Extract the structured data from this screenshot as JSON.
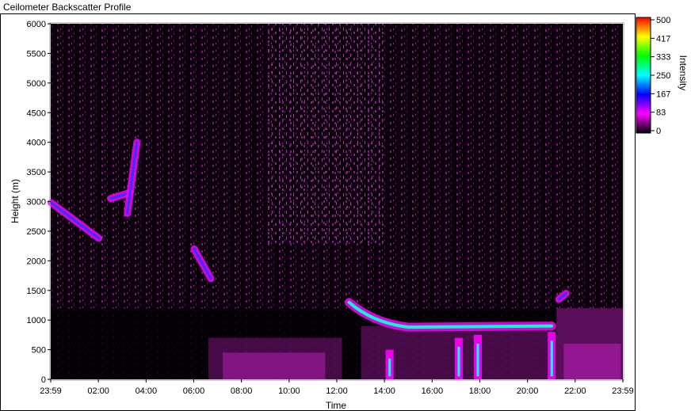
{
  "window": {
    "title": "Ceilometer Backscatter Profile"
  },
  "chart_data": {
    "type": "heatmap",
    "xlabel": "Time",
    "ylabel": "Height (m)",
    "x_ticks": [
      "23:59",
      "02:00",
      "04:00",
      "06:00",
      "08:00",
      "10:00",
      "12:00",
      "14:00",
      "16:00",
      "18:00",
      "20:00",
      "22:00",
      "23:59"
    ],
    "x_range_hours": [
      -0.0167,
      23.983
    ],
    "y_ticks": [
      0,
      500,
      1000,
      1500,
      2000,
      2500,
      3000,
      3500,
      4000,
      4500,
      5000,
      5500,
      6000
    ],
    "ylim": [
      0,
      6000
    ],
    "grid": false,
    "colorbar": {
      "label": "Intensity",
      "ticks": [
        "500",
        "417",
        "333",
        "250",
        "167",
        "83",
        "0"
      ],
      "range": [
        0,
        500
      ],
      "colors": [
        "#000000",
        "#ff00ff",
        "#0000ff",
        "#00ffff",
        "#00ff00",
        "#ffff00",
        "#ff0000"
      ]
    },
    "features": [
      {
        "name": "cloud layer early morning",
        "start_hour": 0.0,
        "end_hour": 2.0,
        "height_start_m": 2980,
        "height_end_m": 2380
      },
      {
        "name": "cloud patch",
        "start_hour": 2.5,
        "end_hour": 3.3,
        "height_start_m": 3050,
        "height_end_m": 3150
      },
      {
        "name": "vertical streak",
        "start_hour": 3.2,
        "end_hour": 3.6,
        "height_start_m": 2800,
        "height_end_m": 4000
      },
      {
        "name": "descending layer",
        "start_hour": 6.0,
        "end_hour": 6.7,
        "height_start_m": 2200,
        "height_end_m": 1700
      },
      {
        "name": "cloud base afternoon",
        "start_hour": 12.5,
        "end_hour": 21.0,
        "height_start_m": 1300,
        "height_end_m": 900
      },
      {
        "name": "late evening layer",
        "start_hour": 21.3,
        "end_hour": 21.6,
        "height_start_m": 1350,
        "height_end_m": 1450
      }
    ],
    "boundary_layer_top_m": 1000,
    "noise_floor_top_m": 6000
  }
}
